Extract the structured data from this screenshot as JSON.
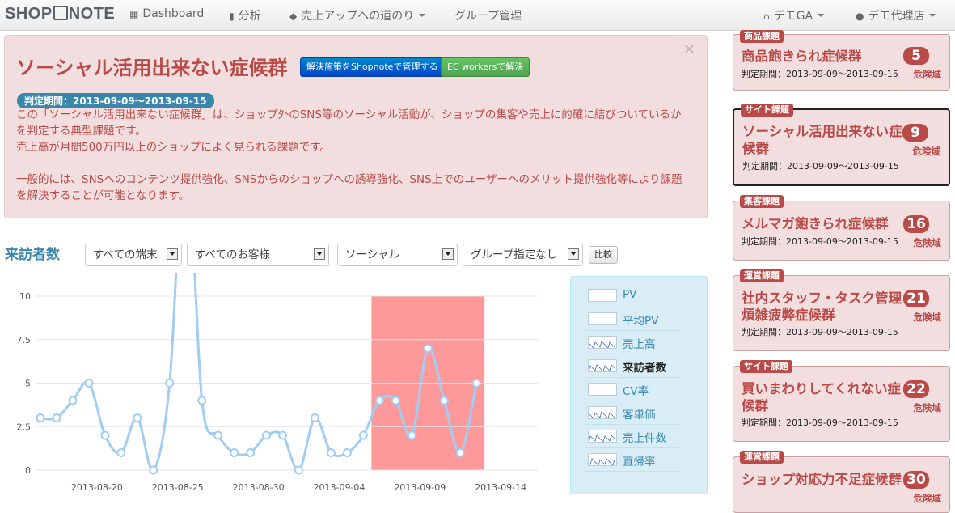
{
  "nav": {
    "brand": "SHOP NOTE",
    "items": [
      {
        "label": "Dashboard",
        "icon": "grid-icon"
      },
      {
        "label": "分析",
        "icon": "bar-chart-icon"
      },
      {
        "label": "売上アップへの道のり",
        "icon": "tag-icon"
      },
      {
        "label": "グループ管理",
        "icon": ""
      }
    ],
    "right": [
      {
        "label": "デモGA",
        "icon": "home-icon"
      },
      {
        "label": "デモ代理店",
        "icon": "user-icon"
      }
    ]
  },
  "alert": {
    "title": "ソーシャル活用出来ない症候群",
    "btn_manage": "解決施策をShopnoteで管理する",
    "btn_ec": "EC workersで解決",
    "close": "×",
    "period": "判定期間：2013-09-09～2013-09-15",
    "body": [
      "この「ソーシャル活用出来ない症候群」は、ショップ外のSNS等のソーシャル活動が、ショップの集客や売上に的確に結びついているかを判定する典型課題です。",
      "売上高が月間500万円以上のショップによく見られる課題です。",
      "",
      "一般的には、SNSへのコンテンツ提供強化、SNSからのショップへの誘導強化、SNS上でのユーザーへのメリット提供強化等により課題を解決することが可能となります。"
    ]
  },
  "section_title": "来訪者数",
  "filters": {
    "device": "すべての端末",
    "customer": "すべてのお客様",
    "channel": "ソーシャル",
    "group": "グループ指定なし",
    "compare": "比較"
  },
  "legend": [
    {
      "label": "PV",
      "active": false
    },
    {
      "label": "平均PV",
      "active": false
    },
    {
      "label": "売上高",
      "active": false
    },
    {
      "label": "来訪者数",
      "active": true
    },
    {
      "label": "CV率",
      "active": false
    },
    {
      "label": "客単価",
      "active": false
    },
    {
      "label": "売上件数",
      "active": false
    },
    {
      "label": "直帰率",
      "active": false
    }
  ],
  "chart_data": {
    "type": "line",
    "x": [
      "2013-08-17",
      "2013-08-18",
      "2013-08-19",
      "2013-08-20",
      "2013-08-21",
      "2013-08-22",
      "2013-08-23",
      "2013-08-24",
      "2013-08-25",
      "2013-08-26",
      "2013-08-27",
      "2013-08-28",
      "2013-08-29",
      "2013-08-30",
      "2013-08-31",
      "2013-09-01",
      "2013-09-02",
      "2013-09-03",
      "2013-09-04",
      "2013-09-05",
      "2013-09-06",
      "2013-09-07",
      "2013-09-08",
      "2013-09-09",
      "2013-09-10",
      "2013-09-11",
      "2013-09-12",
      "2013-09-13",
      "2013-09-14",
      "2013-09-15"
    ],
    "values": [
      3,
      3,
      4,
      5,
      2,
      1,
      3,
      0,
      5,
      19,
      4,
      null,
      2,
      1,
      1,
      2,
      2,
      0,
      null,
      3,
      null,
      1,
      1,
      2,
      4,
      4,
      2,
      7,
      4,
      1,
      5
    ],
    "series": [
      {
        "name": "来訪者数",
        "values": [
          3,
          3,
          4,
          5,
          2,
          1,
          3,
          0,
          5,
          19,
          4,
          2,
          1,
          1,
          2,
          2,
          0,
          3,
          1,
          1,
          2,
          4,
          4,
          2,
          7,
          4,
          1,
          5
        ]
      }
    ],
    "xticks": [
      "2013-08-20",
      "2013-08-25",
      "2013-08-30",
      "2013-09-04",
      "2013-09-09",
      "2013-09-14"
    ],
    "yticks": [
      "0",
      "2.5",
      "5",
      "7.5",
      "10"
    ],
    "ylim": [
      0,
      10
    ],
    "highlight": [
      "2013-09-09",
      "2013-09-15"
    ],
    "line_color": "#9fcdf4",
    "highlight_color": "#ff9999"
  },
  "cards": [
    {
      "tag": "商品課題",
      "title": "商品飽きられ症候群",
      "period": "判定期間：2013-09-09～2013-09-15",
      "score": "5",
      "danger": "危険域",
      "selected": false
    },
    {
      "tag": "サイト課題",
      "title": "ソーシャル活用出来ない症候群",
      "period": "判定期間：2013-09-09～2013-09-15",
      "score": "9",
      "danger": "危険域",
      "selected": true
    },
    {
      "tag": "集客課題",
      "title": "メルマガ飽きられ症候群",
      "period": "判定期間：2013-09-09～2013-09-15",
      "score": "16",
      "danger": "危険域",
      "selected": false
    },
    {
      "tag": "運営課題",
      "title": "社内スタッフ・タスク管理煩雑疲弊症候群",
      "period": "判定期間：2013-09-09～2013-09-15",
      "score": "21",
      "danger": "危険域",
      "selected": false
    },
    {
      "tag": "サイト課題",
      "title": "買いまわりしてくれない症候群",
      "period": "判定期間：2013-09-09～2013-09-15",
      "score": "22",
      "danger": "危険域",
      "selected": false
    },
    {
      "tag": "運営課題",
      "title": "ショップ対応力不足症候群",
      "period": "",
      "score": "30",
      "danger": "危険域",
      "selected": false
    }
  ]
}
